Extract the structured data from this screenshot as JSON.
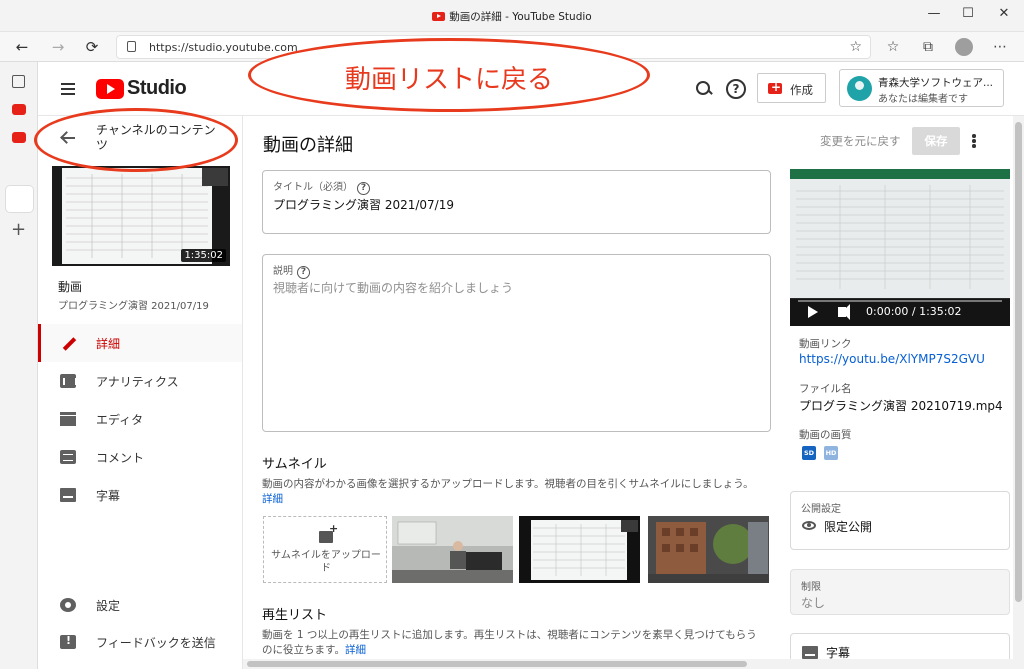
{
  "window": {
    "title": "動画の詳細 - YouTube Studio",
    "minimize": "—",
    "maximize": "☐",
    "close": "✕"
  },
  "browser": {
    "url": "https://studio.youtube.com",
    "nav": {
      "back": "←",
      "forward": "→",
      "reload": "⟳"
    },
    "tools": {
      "favorites": "☆",
      "collections": "⧉",
      "more": "⋯"
    }
  },
  "header": {
    "logo_text": "Studio",
    "create_label": "作成",
    "help_glyph": "?",
    "channel_name": "青森大学ソフトウェア...",
    "channel_role": "あなたは編集者です"
  },
  "annotation": {
    "callout_text": "動画リストに戻る"
  },
  "sidebar": {
    "back_label": "チャンネルのコンテンツ",
    "thumb_duration": "1:35:02",
    "video_heading": "動画",
    "video_title": "プログラミング演習 2021/07/19",
    "items": [
      {
        "label": "詳細",
        "icon": "pencil-icon",
        "active": true
      },
      {
        "label": "アナリティクス",
        "icon": "analytics-icon",
        "active": false
      },
      {
        "label": "エディタ",
        "icon": "editor-icon",
        "active": false
      },
      {
        "label": "コメント",
        "icon": "comment-icon",
        "active": false
      },
      {
        "label": "字幕",
        "icon": "subtitles-icon",
        "active": false
      }
    ],
    "footer": [
      {
        "label": "設定",
        "icon": "gear-icon"
      },
      {
        "label": "フィードバックを送信",
        "icon": "feedback-icon"
      }
    ]
  },
  "main": {
    "title": "動画の詳細",
    "undo_label": "変更を元に戻す",
    "save_label": "保存",
    "title_field": {
      "label": "タイトル（必須）",
      "value": "プログラミング演習 2021/07/19",
      "help": "?"
    },
    "description_field": {
      "label": "説明",
      "placeholder": "視聴者に向けて動画の内容を紹介しましょう",
      "help": "?"
    },
    "thumbnail": {
      "heading": "サムネイル",
      "desc": "動画の内容がわかる画像を選択するかアップロードします。視聴者の目を引くサムネイルにしましょう。",
      "desc_link": "詳細",
      "upload_label": "サムネイルをアップロード"
    },
    "playlist": {
      "heading": "再生リスト",
      "desc": "動画を 1 つ以上の再生リストに追加します。再生リストは、視聴者にコンテンツを素早く見つけてもらうのに役立ちます。",
      "desc_link": "詳細"
    }
  },
  "right": {
    "player_time": "0:00:00 / 1:35:02",
    "link_label": "動画リンク",
    "link_value": "https://youtu.be/XlYMP7S2GVU",
    "file_label": "ファイル名",
    "file_value": "プログラミング演習 20210719.mp4",
    "quality_label": "動画の画質",
    "quality_badges": [
      "SD",
      "HD"
    ],
    "visibility_label": "公開設定",
    "visibility_value": "限定公開",
    "restriction_label": "制限",
    "restriction_value": "なし",
    "subtitles_label": "字幕"
  },
  "colors": {
    "accent_red": "#cc0000",
    "link_blue": "#065fd4",
    "callout_red": "#e8391f"
  }
}
